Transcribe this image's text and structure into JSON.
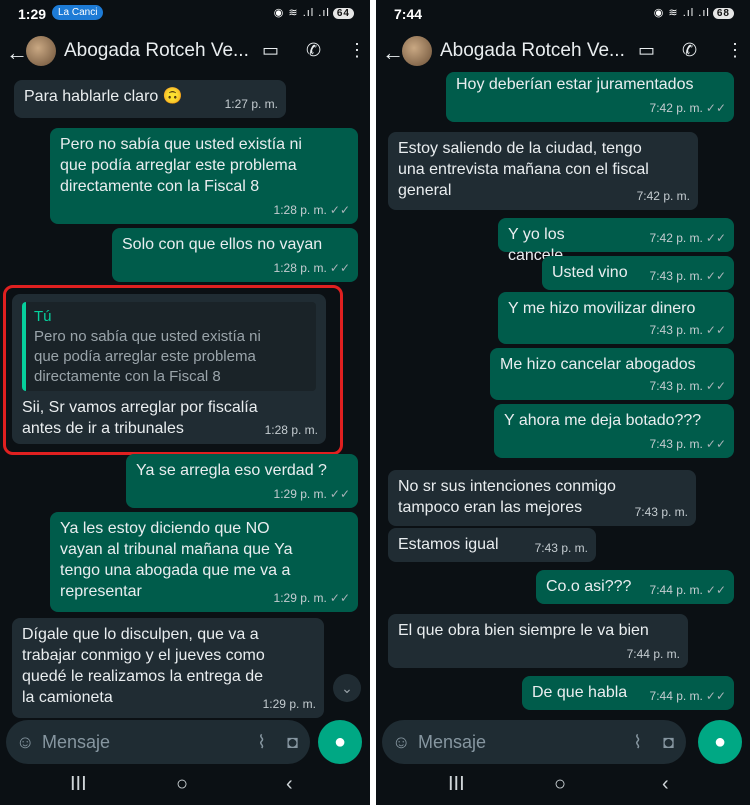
{
  "left": {
    "status": {
      "time": "1:29",
      "notification": "La Canci",
      "icons": "◉ ≋ .ıl .ıl",
      "battery": "64"
    },
    "header": {
      "back_icon": "arrow-left-icon",
      "name": "Abogada Rotceh Ve...",
      "video_icon": "video-icon",
      "call_icon": "phone-icon",
      "menu_icon": "kebab-menu-icon"
    },
    "messages": [
      {
        "dir": "in",
        "text": "Para hablarle claro 🙃",
        "time": "1:27 p. m.",
        "check": ""
      },
      {
        "dir": "out",
        "text": "Pero no sabía que usted existía ni\nque podía arreglar este problema\ndirectamente con la Fiscal 8",
        "time": "1:28 p. m.",
        "check": "✓✓"
      },
      {
        "dir": "out",
        "text": "Solo con que ellos no vayan",
        "time": "1:28 p. m.",
        "check": "✓✓"
      },
      {
        "dir": "in",
        "quote_name": "Tú",
        "quote_text": "Pero no sabía que usted existía ni\nque podía arreglar este problema\ndirectamente con la Fiscal 8",
        "text": "Sii, Sr vamos arreglar por fiscalía\nantes de ir a tribunales",
        "time": "1:28 p. m.",
        "check": ""
      },
      {
        "dir": "out",
        "text": "Ya se arregla eso verdad ?",
        "time": "1:29 p. m.",
        "check": "✓✓"
      },
      {
        "dir": "out",
        "text": "Ya les estoy diciendo que NO\nvayan al tribunal mañana que Ya\ntengo una abogada que me va a\nrepresentar",
        "time": "1:29 p. m.",
        "check": "✓✓"
      },
      {
        "dir": "in",
        "text": "Dígale que lo disculpen, que va a\ntrabajar conmigo y el jueves como\nquedé le realizamos la entrega de\nla camioneta",
        "time": "1:29 p. m.",
        "check": ""
      }
    ],
    "input": {
      "placeholder": "Mensaje"
    }
  },
  "right": {
    "status": {
      "time": "7:44",
      "icons": "◉ ≋ .ıl .ıl",
      "battery": "68"
    },
    "header": {
      "name": "Abogada Rotceh Ve..."
    },
    "messages": [
      {
        "dir": "out",
        "text": "Hoy deberían estar juramentados",
        "time": "7:42 p. m.",
        "check": "✓✓"
      },
      {
        "dir": "in",
        "text": "Estoy saliendo de la ciudad, tengo\nuna entrevista mañana con el fiscal\ngeneral",
        "time": "7:42 p. m.",
        "check": ""
      },
      {
        "dir": "out",
        "text": "Y yo los cancele",
        "time": "7:42 p. m.",
        "check": "✓✓"
      },
      {
        "dir": "out",
        "text": "Usted vino",
        "time": "7:43 p. m.",
        "check": "✓✓"
      },
      {
        "dir": "out",
        "text": "Y me hizo movilizar dinero",
        "time": "7:43 p. m.",
        "check": "✓✓"
      },
      {
        "dir": "out",
        "text": "Me hizo cancelar abogados",
        "time": "7:43 p. m.",
        "check": "✓✓"
      },
      {
        "dir": "out",
        "text": "Y ahora me deja botado???",
        "time": "7:43 p. m.",
        "check": "✓✓"
      },
      {
        "dir": "in",
        "text": "No sr sus intenciones conmigo\ntampoco eran las mejores",
        "time": "7:43 p. m.",
        "check": ""
      },
      {
        "dir": "in",
        "text": "Estamos igual",
        "time": "7:43 p. m.",
        "check": ""
      },
      {
        "dir": "out",
        "text": "Co.o asi???",
        "time": "7:44 p. m.",
        "check": "✓✓"
      },
      {
        "dir": "in",
        "text": "El que obra bien siempre le va bien",
        "time": "7:44 p. m.",
        "check": ""
      },
      {
        "dir": "out",
        "text": "De que habla",
        "time": "7:44 p. m.",
        "check": "✓✓"
      }
    ],
    "input": {
      "placeholder": "Mensaje"
    }
  },
  "navbar": {
    "recents": "III",
    "home": "○",
    "back": "‹"
  }
}
